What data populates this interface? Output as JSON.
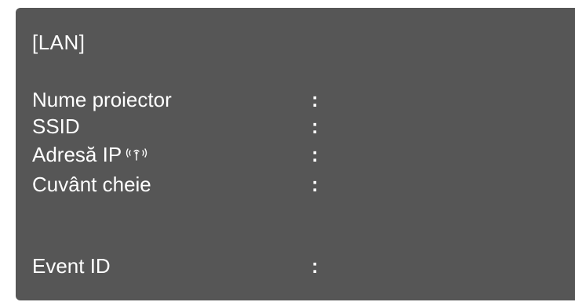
{
  "window": {
    "title": "[LAN]"
  },
  "fields": [
    {
      "label": "Nume proiector",
      "value": ""
    },
    {
      "label": "SSID",
      "value": ""
    },
    {
      "label": "Adresă IP",
      "value": "",
      "icon": "wireless-icon"
    },
    {
      "label": "Cuvânt cheie",
      "value": ""
    },
    {
      "label": "Event ID",
      "value": ""
    }
  ],
  "separator": ":",
  "colors": {
    "background": "#565656",
    "text": "#ffffff",
    "page": "#ffffff"
  }
}
